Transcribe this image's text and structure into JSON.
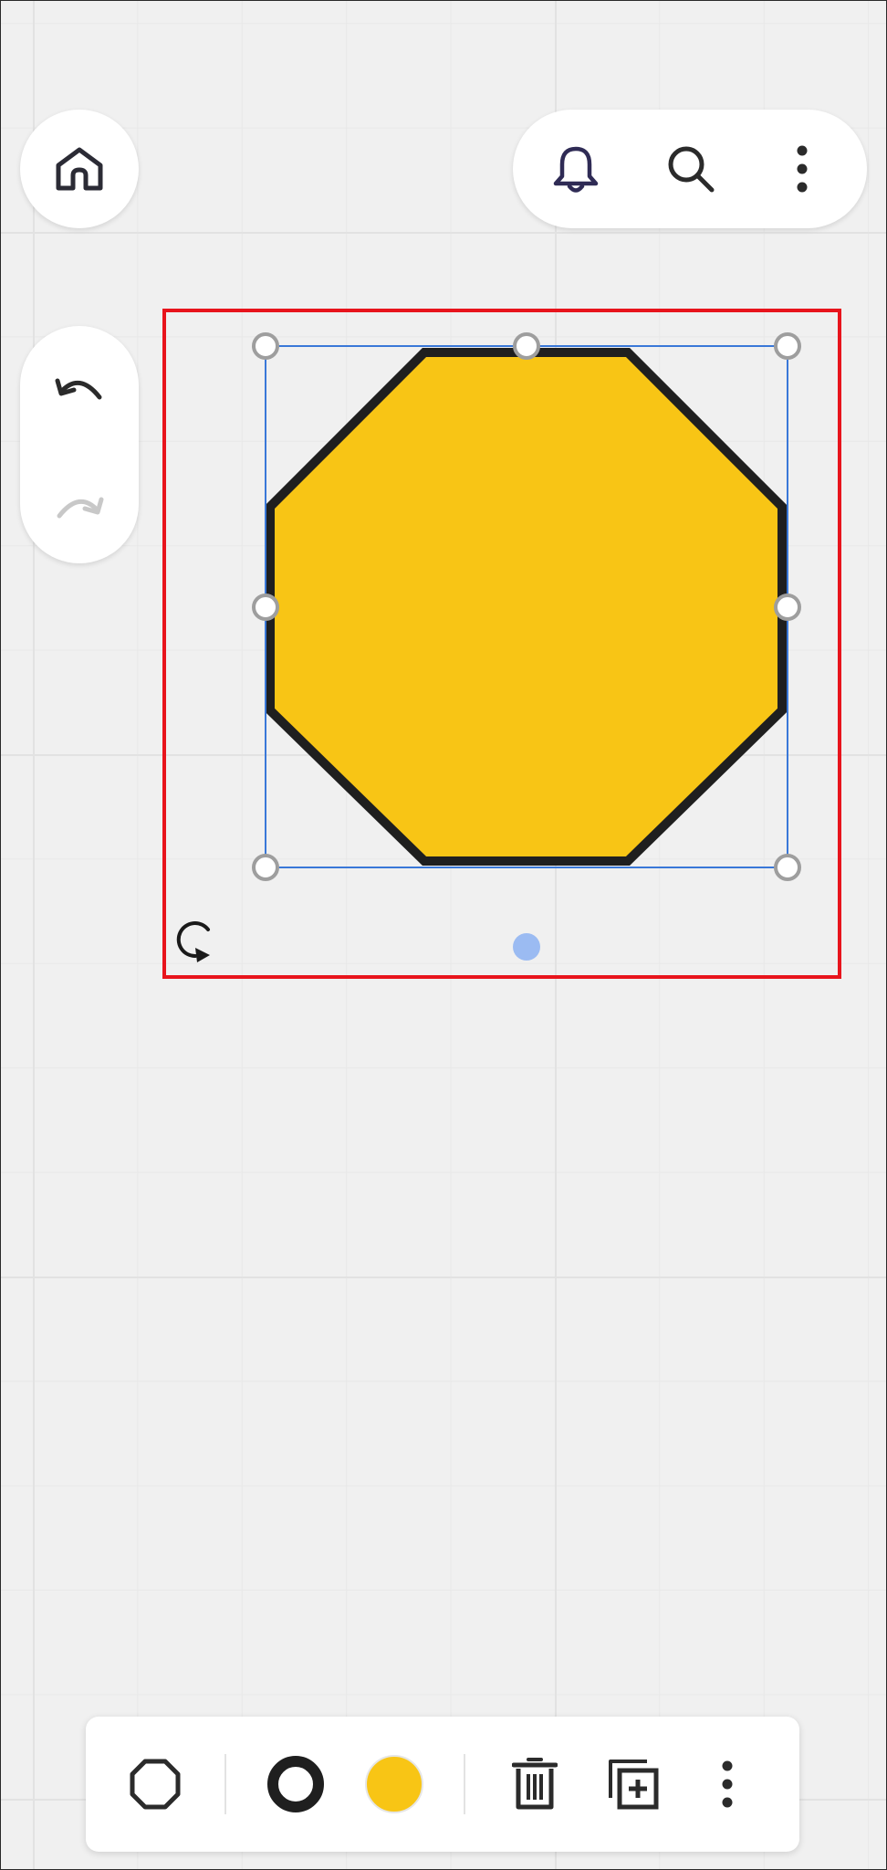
{
  "canvas": {
    "background_color": "#f0f0f0",
    "grid_color": "#e2e2e2"
  },
  "header": {
    "home_icon": "home-icon",
    "notifications_icon": "bell-icon",
    "search_icon": "search-icon",
    "more_icon": "more-vertical-icon"
  },
  "history": {
    "undo_icon": "undo-icon",
    "redo_icon": "redo-icon",
    "redo_enabled": false
  },
  "selection": {
    "frame_color": "#e8141c",
    "handle_stroke": "#9e9e9e",
    "bbox_color": "#3a78d8",
    "rotate_icon": "rotate-icon",
    "anchor_color": "#9bbbf2"
  },
  "shape": {
    "type": "octagon",
    "fill_color": "#f8c515",
    "stroke_color": "#1f1f1f"
  },
  "toolbar": {
    "shape_type_icon": "octagon-icon",
    "stroke_color_swatch": "#1f1f1f",
    "fill_color_swatch": "#f8c515",
    "delete_icon": "trash-icon",
    "duplicate_icon": "duplicate-icon",
    "more_icon": "more-vertical-icon"
  }
}
